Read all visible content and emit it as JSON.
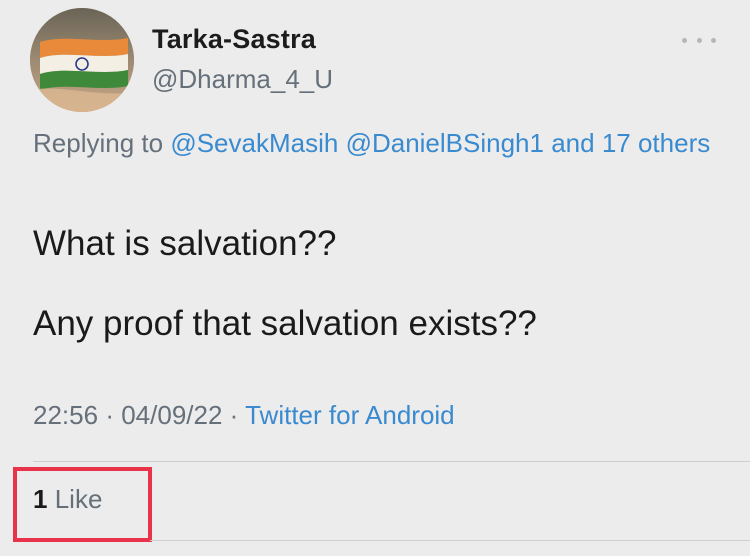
{
  "user": {
    "display_name": "Tarka-Sastra",
    "handle": "@Dharma_4_U"
  },
  "reply": {
    "prefix": "Replying to",
    "mention1": "@SevakMasih",
    "mention2": "@DanielBSingh1",
    "connector": "and",
    "others": "17 others"
  },
  "tweet": {
    "line1": "What is salvation??",
    "line2": "Any proof that salvation exists??"
  },
  "meta": {
    "time": "22:56",
    "separator": "·",
    "date": "04/09/22",
    "source": "Twitter for Android"
  },
  "stats": {
    "like_count": "1",
    "like_label": "Like"
  },
  "colors": {
    "link": "#3a8ad0",
    "muted": "#66707a",
    "highlight_box": "#e8334a",
    "background": "#ececec"
  },
  "icons": {
    "more": "more-horizontal-icon",
    "avatar": "indian-flag-avatar"
  }
}
